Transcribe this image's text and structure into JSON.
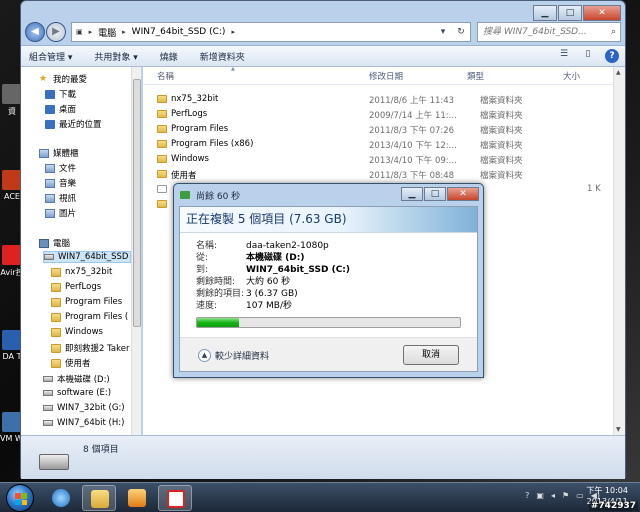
{
  "explorer": {
    "address_segments": [
      "電腦",
      "WIN7_64bit_SSD (C:)"
    ],
    "search_placeholder": "搜尋 WIN7_64bit_SSD...",
    "toolbar": {
      "organize": "組合管理 ▾",
      "share": "共用對象 ▾",
      "burn": "燒錄",
      "new_folder": "新增資料夾"
    },
    "columns": [
      "名稱",
      "修改日期",
      "類型",
      "大小"
    ],
    "files": [
      {
        "name": "nx75_32bit",
        "date": "2011/8/6 上午 11:43",
        "type": "檔案資料夾",
        "size": ""
      },
      {
        "name": "PerfLogs",
        "date": "2009/7/14 上午 11:...",
        "type": "檔案資料夾",
        "size": ""
      },
      {
        "name": "Program Files",
        "date": "2011/8/3 下午 07:26",
        "type": "檔案資料夾",
        "size": ""
      },
      {
        "name": "Program Files (x86)",
        "date": "2013/4/10 下午 12:...",
        "type": "檔案資料夾",
        "size": ""
      },
      {
        "name": "Windows",
        "date": "2013/4/10 下午 09:...",
        "type": "檔案資料夾",
        "size": ""
      },
      {
        "name": "使用者",
        "date": "2011/8/3 下午 08:48",
        "type": "檔案資料夾",
        "size": ""
      },
      {
        "name": "",
        "date": "",
        "type": "",
        "size": "1 K"
      },
      {
        "name": "",
        "date": "",
        "type": "",
        "size": ""
      }
    ],
    "sidebar": {
      "favorites": "我的最愛",
      "downloads": "下載",
      "desktop": "桌面",
      "recent": "最近的位置",
      "libraries": "媒體櫃",
      "documents": "文件",
      "music": "音樂",
      "videos": "視訊",
      "pictures": "圖片",
      "computer": "電腦",
      "drive_c": "WIN7_64bit_SSD",
      "sub_items": [
        "nx75_32bit",
        "PerfLogs",
        "Program Files",
        "Program Files (",
        "Windows",
        "即刻救援2 Taker",
        "使用者"
      ],
      "drive_d": "本機磁碟 (D:)",
      "drive_e": "software (E:)",
      "drive_g": "WIN7_32bit (G:)",
      "drive_h": "WIN7_64bit (H:)"
    },
    "status": "8 個項目"
  },
  "dialog": {
    "title": "尚餘 60 秒",
    "heading": "正在複製 5 個項目 (7.63 GB)",
    "fields": [
      {
        "key": "名稱:",
        "value": "daa-taken2-1080p",
        "bold": false
      },
      {
        "key": "從:",
        "value": "本機磁碟 (D:)",
        "bold": true
      },
      {
        "key": "到:",
        "value": "WIN7_64bit_SSD (C:)",
        "bold": true
      },
      {
        "key": "剩餘時間:",
        "value": "大約 60 秒",
        "bold": false
      },
      {
        "key": "剩餘的項目:",
        "value": "3 (6.37 GB)",
        "bold": false
      },
      {
        "key": "速度:",
        "value": "107 MB/秒",
        "bold": false
      }
    ],
    "progress_fraction": 0.16,
    "details_label": "較少詳細資料",
    "cancel_label": "取消"
  },
  "desktop_icons": [
    "資",
    "ACE",
    "Avir控",
    "DA T",
    "VM Wor"
  ],
  "taskbar": {
    "time": "下午 10:04",
    "date": "2013/4/11"
  },
  "watermark": "#742937"
}
